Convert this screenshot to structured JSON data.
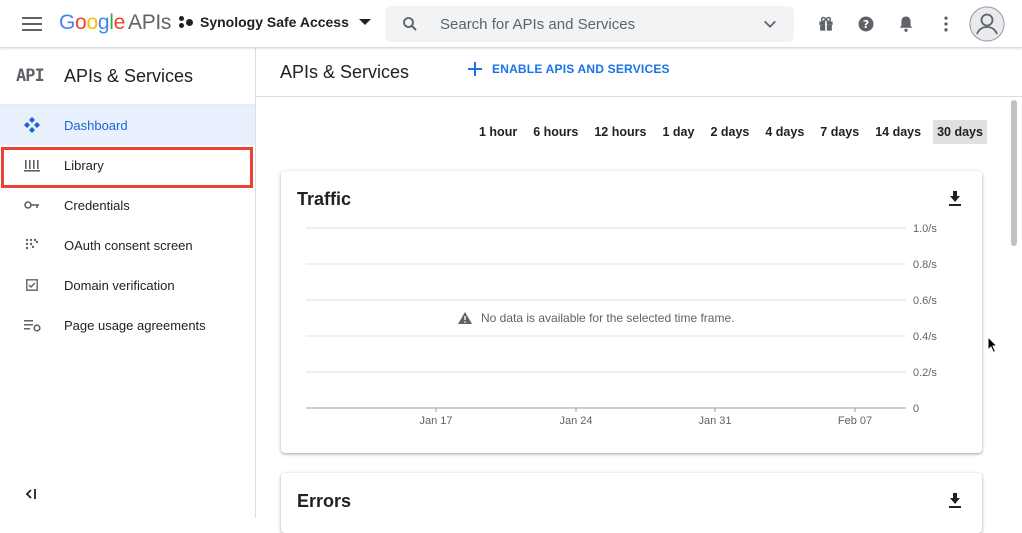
{
  "header": {
    "logo_google": "Google",
    "logo_apis": "APIs",
    "project_name": "Synology Safe Access",
    "search_placeholder": "Search for APIs and Services"
  },
  "sidebar": {
    "badge": "API",
    "title": "APIs & Services",
    "items": [
      {
        "label": "Dashboard",
        "icon": "dashboard-icon",
        "active": true
      },
      {
        "label": "Library",
        "icon": "library-icon",
        "active": false,
        "highlighted": true
      },
      {
        "label": "Credentials",
        "icon": "key-icon",
        "active": false
      },
      {
        "label": "OAuth consent screen",
        "icon": "oauth-icon",
        "active": false
      },
      {
        "label": "Domain verification",
        "icon": "checkbox-icon",
        "active": false
      },
      {
        "label": "Page usage agreements",
        "icon": "settings-list-icon",
        "active": false
      }
    ]
  },
  "main": {
    "title": "APIs & Services",
    "enable_button": "ENABLE APIS AND SERVICES",
    "time_ranges": [
      "1 hour",
      "6 hours",
      "12 hours",
      "1 day",
      "2 days",
      "4 days",
      "7 days",
      "14 days",
      "30 days"
    ],
    "selected_range": "30 days",
    "traffic_card": {
      "title": "Traffic",
      "no_data": "No data is available for the selected time frame."
    },
    "errors_card": {
      "title": "Errors"
    }
  },
  "colors": {
    "accent": "#1a73e8",
    "active_bg": "#e8f0fe",
    "highlight_border": "#ea4335"
  },
  "chart_data": {
    "type": "line",
    "title": "Traffic",
    "x_ticks": [
      "Jan 17",
      "Jan 24",
      "Jan 31",
      "Feb 07"
    ],
    "y_ticks": [
      "0",
      "0.2/s",
      "0.4/s",
      "0.6/s",
      "0.8/s",
      "1.0/s"
    ],
    "ylim": [
      0,
      1.0
    ],
    "series": [],
    "grid": true
  }
}
